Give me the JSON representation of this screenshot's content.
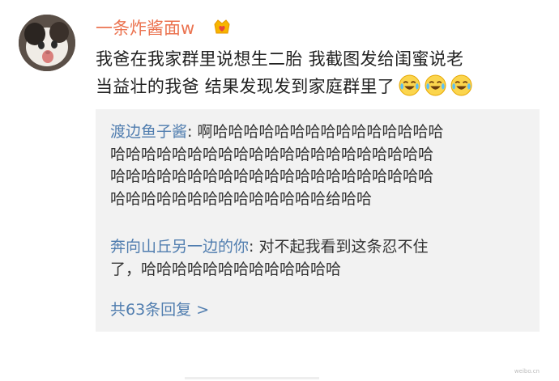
{
  "post": {
    "username": "一条炸酱面w",
    "badge_icon": "crown-heart-icon",
    "text_lines": [
      "我爸在我家群里说想生二胎 我截图发给闺蜜说老",
      "当益壮的我爸 结果发现发到家庭群里了"
    ],
    "emoji_icon": "laugh-cry-emoji-icon",
    "emoji_count": 3
  },
  "replies": {
    "items": [
      {
        "name": "渡边鱼子酱",
        "lines": [
          ": 啊哈哈哈哈哈哈哈哈哈哈哈哈哈哈哈",
          "哈哈哈哈哈哈哈哈哈哈哈哈哈哈哈哈哈哈哈哈哈",
          "哈哈哈哈哈哈哈哈哈哈哈哈哈哈哈哈哈哈哈哈哈",
          "哈哈哈哈哈哈哈哈哈哈哈哈哈哈给哈哈"
        ]
      },
      {
        "name": "奔向山丘另一边的你",
        "lines": [
          ": 对不起我看到这条忍不住",
          "了，哈哈哈哈哈哈哈哈哈哈哈哈哈"
        ]
      }
    ],
    "more_label": "共63条回复 >"
  },
  "watermark": "weibo.cn"
}
